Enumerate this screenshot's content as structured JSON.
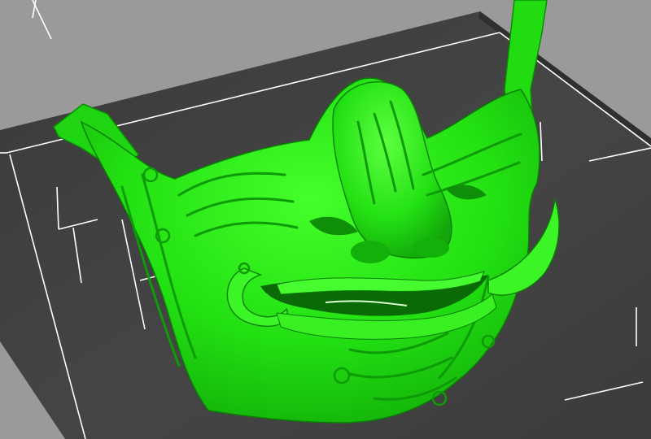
{
  "viewport": {
    "background_color": "#9a9a9a",
    "build_plate_color": "#3c3c3c",
    "build_plate_edge_color": "#2e2e2e",
    "grid_line_color": "#ffffff",
    "model_color": "#22e012",
    "model_shadow_color": "#0b6a06",
    "model_highlight_color": "#7bff5e"
  },
  "model": {
    "icon": "oni-mask-model"
  }
}
